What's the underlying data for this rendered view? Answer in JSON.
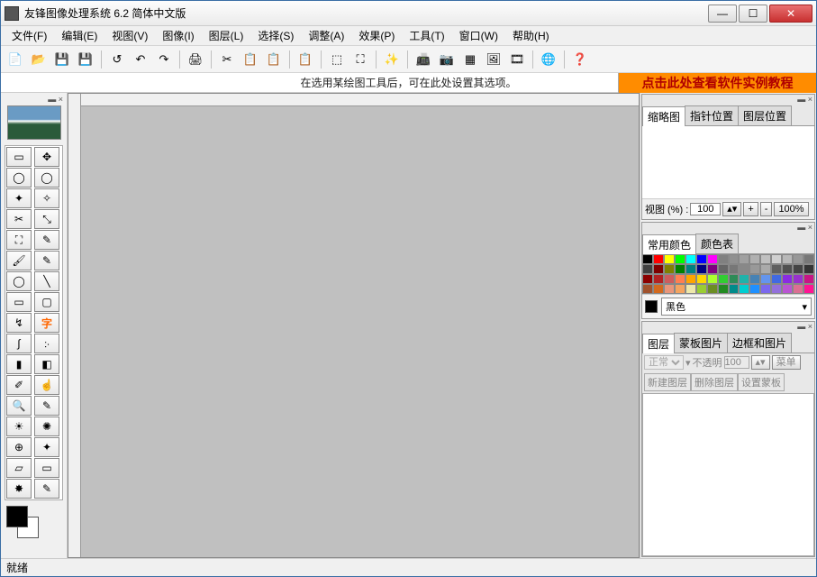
{
  "title": "友锋图像处理系统 6.2 简体中文版",
  "menus": [
    "文件(F)",
    "编辑(E)",
    "视图(V)",
    "图像(I)",
    "图层(L)",
    "选择(S)",
    "调整(A)",
    "效果(P)",
    "工具(T)",
    "窗口(W)",
    "帮助(H)"
  ],
  "toolbar_icons": [
    "new",
    "open",
    "save",
    "save-all",
    "revert",
    "undo",
    "redo",
    "print",
    "cut",
    "copy",
    "paste",
    "paste-special",
    "crop",
    "fit",
    "effects",
    "scanner",
    "camera",
    "frame",
    "gallery",
    "slideshow",
    "web",
    "help"
  ],
  "options_hint": "在选用某绘图工具后，可在此处设置其选项。",
  "promo_text": "点击此处查看软件实例教程",
  "tools": [
    {
      "n": "rect-select",
      "g": "▭"
    },
    {
      "n": "move",
      "g": "✥"
    },
    {
      "n": "ellipse-select",
      "g": "◯"
    },
    {
      "n": "lasso",
      "g": "◯"
    },
    {
      "n": "polygon-lasso",
      "g": "✦"
    },
    {
      "n": "magic-wand",
      "g": "✧"
    },
    {
      "n": "crop",
      "g": "✂"
    },
    {
      "n": "transform",
      "g": "⤡"
    },
    {
      "n": "free-transform",
      "g": "⛶"
    },
    {
      "n": "eyedropper",
      "g": "✎"
    },
    {
      "n": "brush",
      "g": "🖌"
    },
    {
      "n": "pencil",
      "g": "✎"
    },
    {
      "n": "ellipse-shape",
      "g": "◯"
    },
    {
      "n": "line",
      "g": "╲"
    },
    {
      "n": "rect-shape",
      "g": "▭"
    },
    {
      "n": "round-rect",
      "g": "▢"
    },
    {
      "n": "path",
      "g": "↯"
    },
    {
      "n": "text",
      "g": "字"
    },
    {
      "n": "curve",
      "g": "∫"
    },
    {
      "n": "spray",
      "g": "჻"
    },
    {
      "n": "fill",
      "g": "▮"
    },
    {
      "n": "gradient",
      "g": "◧"
    },
    {
      "n": "dropper",
      "g": "✐"
    },
    {
      "n": "smudge",
      "g": "☝"
    },
    {
      "n": "zoom",
      "g": "🔍"
    },
    {
      "n": "highlight",
      "g": "✎"
    },
    {
      "n": "dodge",
      "g": "☀"
    },
    {
      "n": "burn",
      "g": "✺"
    },
    {
      "n": "clone",
      "g": "⊕"
    },
    {
      "n": "heal",
      "g": "✦"
    },
    {
      "n": "eraser",
      "g": "▱"
    },
    {
      "n": "red-eye",
      "g": "▭"
    },
    {
      "n": "effect-brush",
      "g": "✸"
    },
    {
      "n": "measure",
      "g": "✎"
    }
  ],
  "nav": {
    "tabs": [
      "缩略图",
      "指针位置",
      "图层位置"
    ],
    "view_label": "视图 (%) :",
    "view_value": "100",
    "btn_plus": "+",
    "btn_minus": "-",
    "btn_100": "100%"
  },
  "colors": {
    "tabs": [
      "常用颜色",
      "颜色表"
    ],
    "current_name": "黑色",
    "palette": [
      "#000000",
      "#ff0000",
      "#ffff00",
      "#00ff00",
      "#00ffff",
      "#0000ff",
      "#ff00ff",
      "#808080",
      "#909090",
      "#a0a0a0",
      "#b0b0b0",
      "#c0c0c0",
      "#d0d0d0",
      "#b8b8b8",
      "#989898",
      "#787878",
      "#404040",
      "#800000",
      "#808000",
      "#008000",
      "#008080",
      "#000080",
      "#800080",
      "#666666",
      "#777777",
      "#888888",
      "#999999",
      "#aaaaaa",
      "#606060",
      "#505050",
      "#454545",
      "#353535",
      "#8b0000",
      "#b22222",
      "#cd5c5c",
      "#ff7f50",
      "#ffa500",
      "#ffd700",
      "#adff2f",
      "#32cd32",
      "#2e8b57",
      "#20b2aa",
      "#4682b4",
      "#6495ed",
      "#4169e1",
      "#8a2be2",
      "#9932cc",
      "#c71585",
      "#a0522d",
      "#d2691e",
      "#e9967a",
      "#f4a460",
      "#eee8aa",
      "#9acd32",
      "#6b8e23",
      "#228b22",
      "#008b8b",
      "#00ced1",
      "#1e90ff",
      "#7b68ee",
      "#9370db",
      "#ba55d3",
      "#db7093",
      "#ff1493"
    ]
  },
  "layers": {
    "tabs": [
      "图层",
      "蒙板图片",
      "边框和图片"
    ],
    "mode": "正常",
    "opacity_label": "不透明",
    "opacity": "100",
    "menu": "菜单",
    "btns": [
      "新建图层",
      "删除图层",
      "设置蒙板"
    ]
  },
  "status": "就绪"
}
